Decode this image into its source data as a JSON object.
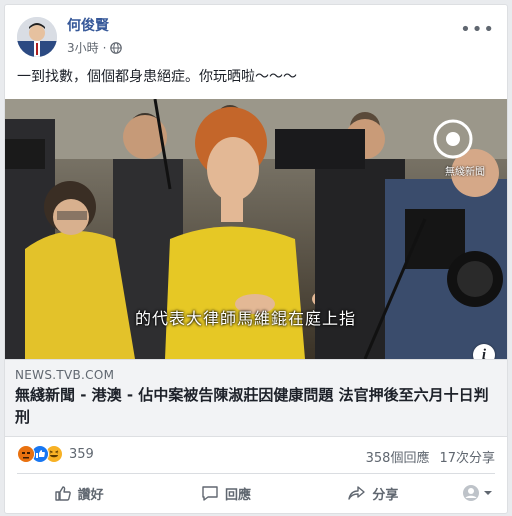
{
  "post": {
    "author": "何俊賢",
    "time": "3小時",
    "text": "一到找數，個個都身患絕症。你玩晒啦～～～"
  },
  "media": {
    "subtitle": "的代表大律師馬維錕在庭上指",
    "watermark": "無綫新聞",
    "info_label": "i"
  },
  "link": {
    "domain": "NEWS.TVB.COM",
    "title": "無綫新聞 - 港澳 - 佔中案被告陳淑莊因健康問題 法官押後至六月十日判刑"
  },
  "reactions": {
    "count": "359",
    "icons": [
      "angry-icon",
      "like-icon",
      "haha-icon"
    ]
  },
  "stats": {
    "comments": "358個回應",
    "shares": "17次分享"
  },
  "actions": {
    "like": "讚好",
    "comment": "回應",
    "share": "分享"
  },
  "colors": {
    "link_blue": "#365899",
    "like_blue": "#1877f2",
    "angry": "#e9710f",
    "haha": "#f7b125"
  }
}
